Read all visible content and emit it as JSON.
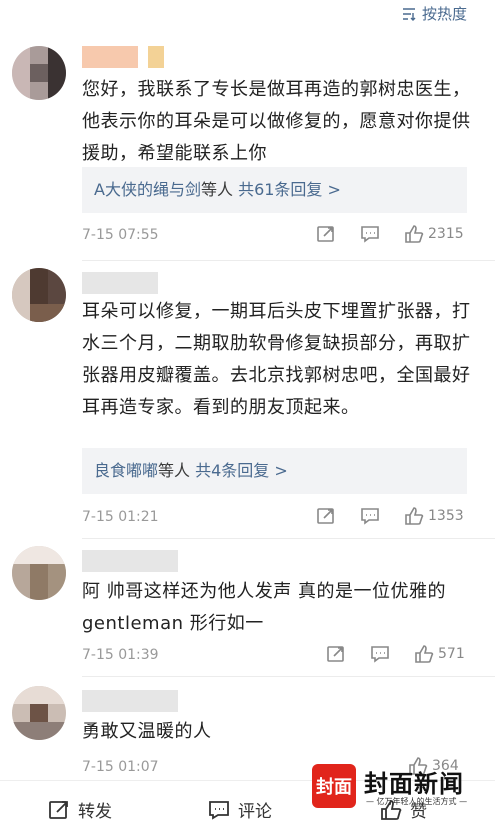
{
  "sort": {
    "label": "按热度"
  },
  "comments": [
    {
      "text": "您好，我联系了专长是做耳再造的郭树忠医生，他表示你的耳朵是可以做修复的，愿意对你提供援助，希望能联系上你",
      "reply": {
        "who": "A大侠的绳与剑",
        "mid": "等人",
        "count": "共61条回复 >"
      },
      "time": "7-15 07:55",
      "likes": "2315"
    },
    {
      "text": "耳朵可以修复，一期耳后头皮下埋置扩张器，打水三个月，二期取肋软骨修复缺损部分，再取扩张器用皮瓣覆盖。去北京找郭树忠吧，全国最好耳再造专家。看到的朋友顶起来。",
      "reply": {
        "who": "良食嘟嘟",
        "mid": "等人",
        "count": "共4条回复 >"
      },
      "time": "7-15 01:21",
      "likes": "1353"
    },
    {
      "text": "阿 帅哥这样还为他人发声 真的是一位优雅的gentleman 形行如一",
      "time": "7-15 01:39",
      "likes": "571"
    },
    {
      "text": "勇敢又温暖的人",
      "time": "7-15 01:07",
      "likes": "364"
    }
  ],
  "bottom_bar": {
    "repost": "转发",
    "comment": "评论",
    "like": "赞"
  },
  "watermark": {
    "logo": "封面",
    "title": "封面新闻",
    "slogan": "— 亿万年轻人的生活方式 —"
  }
}
